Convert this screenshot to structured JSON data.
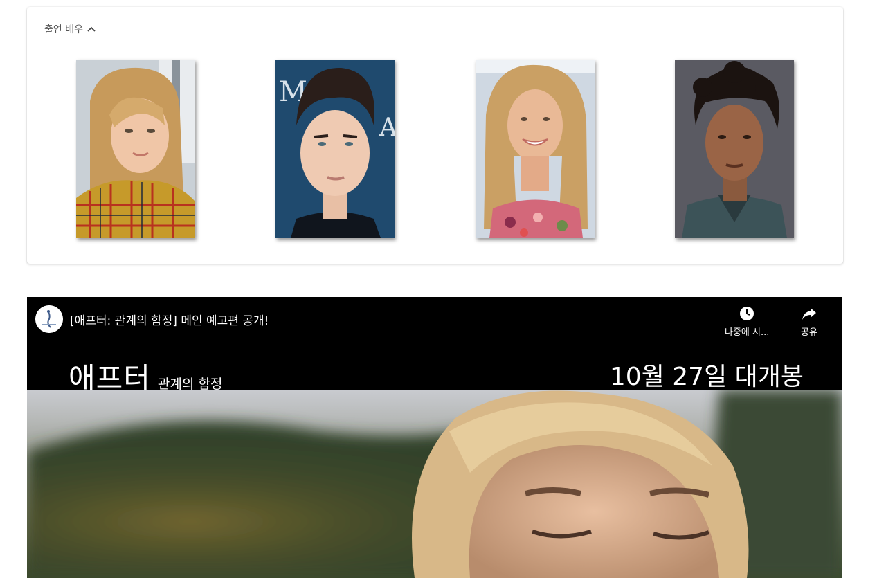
{
  "cast": {
    "header_label": "출연 배우",
    "toggle_icon": "chevron-up-icon",
    "actors": [
      {
        "photo": "actor-photo-1"
      },
      {
        "photo": "actor-photo-2"
      },
      {
        "photo": "actor-photo-3"
      },
      {
        "photo": "actor-photo-4"
      }
    ]
  },
  "video": {
    "title": "[애프터: 관계의 함정] 메인 예고편 공개!",
    "watch_later_label": "나중에 시...",
    "share_label": "공유",
    "banner_title": "애프터",
    "banner_subtitle": "관계의 함정",
    "banner_date": "10월 27일 대개봉"
  },
  "colors": {
    "video_bg": "#000000",
    "card_bg": "#ffffff",
    "header_text": "#555555"
  }
}
